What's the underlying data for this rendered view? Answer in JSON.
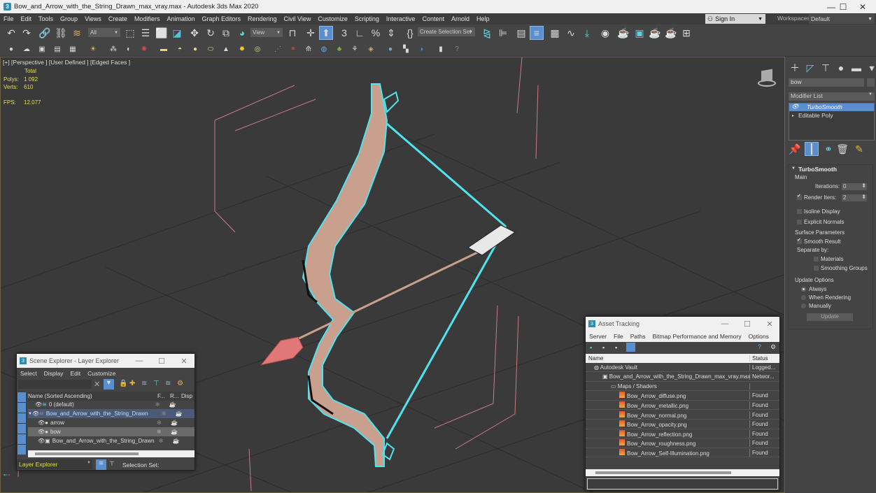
{
  "window": {
    "title": "Bow_and_Arrow_with_the_String_Drawn_max_vray.max - Autodesk 3ds Max 2020",
    "app_icon": "3ds-max-icon",
    "controls": [
      "minimize",
      "maximize",
      "close"
    ]
  },
  "menubar": {
    "items": [
      "File",
      "Edit",
      "Tools",
      "Group",
      "Views",
      "Create",
      "Modifiers",
      "Animation",
      "Graph Editors",
      "Rendering",
      "Civil View",
      "Customize",
      "Scripting",
      "Interactive",
      "Content",
      "Arnold",
      "Help"
    ],
    "sign_in": "Sign In",
    "workspaces_label": "Workspaces:",
    "workspace_value": "Default"
  },
  "toolbar": {
    "selection_filter": "All",
    "ref_coord": "View",
    "selection_set": "Create Selection Set"
  },
  "viewport": {
    "label": "[+] [Perspective ] [User Defined ] [Edged Faces ]",
    "stats": {
      "header": "Total",
      "polys_label": "Polys:",
      "polys_value": "1 092",
      "verts_label": "Verts:",
      "verts_value": "610",
      "fps_label": "FPS:",
      "fps_value": "12.077"
    },
    "colors": {
      "background": "#3a3a3a",
      "selection": "#4fe3f0",
      "wood": "#c9a08e",
      "arrowhead": "#e07878",
      "grid": "#2c2c2c"
    }
  },
  "command_panel": {
    "search_value": "bow",
    "modifier_list_label": "Modifier List",
    "stack": [
      {
        "label": "TurboSmooth",
        "selected": true
      },
      {
        "label": "Editable Poly",
        "selected": false
      }
    ],
    "rollout_title": "TurboSmooth",
    "main_label": "Main",
    "iterations_label": "Iterations:",
    "iterations_value": "0",
    "render_iters_label": "Render Iters:",
    "render_iters_value": "2",
    "render_iters_checked": true,
    "isoline_display": "Isoline Display",
    "explicit_normals": "Explicit Normals",
    "surface_params_label": "Surface Parameters",
    "smooth_result": "Smooth Result",
    "separate_by": "Separate by:",
    "materials": "Materials",
    "smoothing_groups": "Smoothing Groups",
    "update_options_label": "Update Options",
    "update_options": [
      {
        "label": "Always",
        "selected": true
      },
      {
        "label": "When Rendering",
        "selected": false
      },
      {
        "label": "Manually",
        "selected": false
      }
    ],
    "update_button": "Update"
  },
  "scene_explorer": {
    "title": "Scene Explorer - Layer Explorer",
    "menu": [
      "Select",
      "Display",
      "Edit",
      "Customize"
    ],
    "columns": [
      "Name (Sorted Ascending)",
      "F...",
      "R...",
      "Disp"
    ],
    "rows": [
      {
        "name": "0 (default)",
        "level": 0
      },
      {
        "name": "Bow_and_Arrow_with_the_String_Drawn",
        "level": 0,
        "expanded": true,
        "highlight": true
      },
      {
        "name": "arrow",
        "level": 1
      },
      {
        "name": "bow",
        "level": 1,
        "selected": true
      },
      {
        "name": "Bow_and_Arrow_with_the_String_Drawn",
        "level": 1
      }
    ],
    "footer_select": "Layer Explorer",
    "selection_set_label": "Selection Set:"
  },
  "asset_tracking": {
    "title": "Asset Tracking",
    "menu": [
      "Server",
      "File",
      "Paths",
      "Bitmap Performance and Memory",
      "Options"
    ],
    "columns": [
      "Name",
      "Status"
    ],
    "rows": [
      {
        "name": "Autodesk Vault",
        "status": "Logged...",
        "level": 0,
        "icon": "vault-icon"
      },
      {
        "name": "Bow_and_Arrow_with_the_String_Drawn_max_vray.max",
        "status": "Networ...",
        "level": 1,
        "icon": "max-file-icon"
      },
      {
        "name": "Maps / Shaders",
        "status": "",
        "level": 2,
        "icon": "maps-icon"
      },
      {
        "name": "Bow_Arrow_diffuse.png",
        "status": "Found",
        "level": 3,
        "icon": "image-file-icon"
      },
      {
        "name": "Bow_Arrow_metallic.png",
        "status": "Found",
        "level": 3,
        "icon": "image-file-icon"
      },
      {
        "name": "Bow_Arrow_normal.png",
        "status": "Found",
        "level": 3,
        "icon": "image-file-icon"
      },
      {
        "name": "Bow_Arrow_opacity.png",
        "status": "Found",
        "level": 3,
        "icon": "image-file-icon"
      },
      {
        "name": "Bow_Arrow_reflection.png",
        "status": "Found",
        "level": 3,
        "icon": "image-file-icon"
      },
      {
        "name": "Bow_Arrow_roughness.png",
        "status": "Found",
        "level": 3,
        "icon": "image-file-icon"
      },
      {
        "name": "Bow_Arrow_Self-Illumination.png",
        "status": "Found",
        "level": 3,
        "icon": "image-file-icon"
      }
    ]
  }
}
